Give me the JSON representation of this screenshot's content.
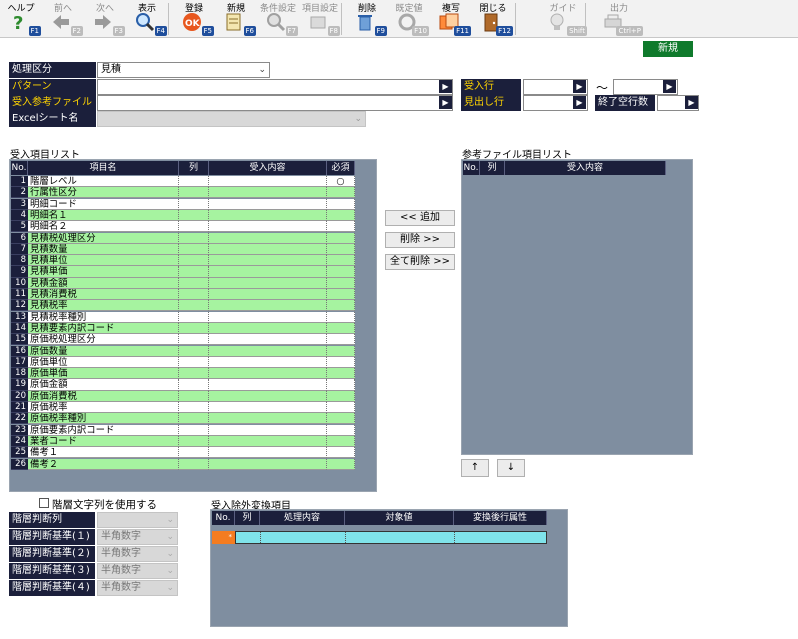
{
  "toolbar": {
    "items": [
      {
        "label": "ヘルプ",
        "key": "F1",
        "icon": "help-icon",
        "disabled": false
      },
      {
        "label": "前へ",
        "key": "F2",
        "icon": "arrow-left-icon",
        "disabled": true
      },
      {
        "label": "次へ",
        "key": "F3",
        "icon": "arrow-right-icon",
        "disabled": true
      },
      {
        "label": "表示",
        "key": "F4",
        "icon": "magnifier-icon",
        "disabled": false
      },
      {
        "label": "登録",
        "key": "F5",
        "icon": "ok-icon",
        "disabled": false
      },
      {
        "label": "新規",
        "key": "F6",
        "icon": "new-document-icon",
        "disabled": false
      },
      {
        "label": "条件設定",
        "key": "F7",
        "icon": "condition-search-icon",
        "disabled": true
      },
      {
        "label": "項目設定",
        "key": "F8",
        "icon": "item-settings-icon",
        "disabled": true
      },
      {
        "label": "削除",
        "key": "F9",
        "icon": "trash-icon",
        "disabled": false
      },
      {
        "label": "既定値",
        "key": "F10",
        "icon": "default-value-icon",
        "disabled": true
      },
      {
        "label": "複写",
        "key": "F11",
        "icon": "copy-icon",
        "disabled": false
      },
      {
        "label": "閉じる",
        "key": "F12",
        "icon": "close-door-icon",
        "disabled": false
      },
      {
        "label": "ガイド",
        "key": "Shift",
        "icon": "lightbulb-icon",
        "disabled": true
      },
      {
        "label": "出力",
        "key": "Ctrl+P",
        "icon": "print-icon",
        "disabled": true
      }
    ],
    "colors": {
      "fkey": "#1f4e9c",
      "fkey_disabled": "#bcbcbc"
    }
  },
  "mode_badge": "新規",
  "form": {
    "kubun_label": "処理区分",
    "kubun_value": "見積",
    "pattern_label": "パターン",
    "pattern_value": "",
    "ref_file_label": "受入参考ファイル",
    "ref_file_value": "",
    "sheet_label": "Excelシート名",
    "sheet_value": "",
    "import_row_label": "受入行",
    "import_row_from": "",
    "tilde": "～",
    "import_row_to": "",
    "header_row_label": "見出し行",
    "header_row_value": "",
    "end_blank_label": "終了空行数",
    "end_blank_value": ""
  },
  "import_list": {
    "title": "受入項目リスト",
    "headers": [
      "No.",
      "項目名",
      "列",
      "受入内容",
      "必須"
    ],
    "rows": [
      {
        "no": "1",
        "name": "階層レベル",
        "required": "○"
      },
      {
        "no": "2",
        "name": "行属性区分",
        "required": ""
      },
      {
        "no": "3",
        "name": "明細コード",
        "required": ""
      },
      {
        "no": "4",
        "name": "明細名１",
        "required": ""
      },
      {
        "no": "5",
        "name": "明細名２",
        "required": ""
      },
      {
        "no": "6",
        "name": "見積税処理区分",
        "required": ""
      },
      {
        "no": "7",
        "name": "見積数量",
        "required": ""
      },
      {
        "no": "8",
        "name": "見積単位",
        "required": ""
      },
      {
        "no": "9",
        "name": "見積単価",
        "required": ""
      },
      {
        "no": "10",
        "name": "見積金額",
        "required": ""
      },
      {
        "no": "11",
        "name": "見積消費税",
        "required": ""
      },
      {
        "no": "12",
        "name": "見積税率",
        "required": ""
      },
      {
        "no": "13",
        "name": "見積税率種別",
        "required": ""
      },
      {
        "no": "14",
        "name": "見積要素内訳コード",
        "required": ""
      },
      {
        "no": "15",
        "name": "原価税処理区分",
        "required": ""
      },
      {
        "no": "16",
        "name": "原価数量",
        "required": ""
      },
      {
        "no": "17",
        "name": "原価単位",
        "required": ""
      },
      {
        "no": "18",
        "name": "原価単価",
        "required": ""
      },
      {
        "no": "19",
        "name": "原価金額",
        "required": ""
      },
      {
        "no": "20",
        "name": "原価消費税",
        "required": ""
      },
      {
        "no": "21",
        "name": "原価税率",
        "required": ""
      },
      {
        "no": "22",
        "name": "原価税率種別",
        "required": ""
      },
      {
        "no": "23",
        "name": "原価要素内訳コード",
        "required": ""
      },
      {
        "no": "24",
        "name": "業者コード",
        "required": ""
      },
      {
        "no": "25",
        "name": "備考１",
        "required": ""
      },
      {
        "no": "26",
        "name": "備考２",
        "required": ""
      }
    ],
    "colors": {
      "green": "#a6f3a0",
      "white": "#ffffff"
    }
  },
  "buttons": {
    "add": "<< 追加",
    "remove": "削除 >>",
    "remove_all": "全て削除 >>",
    "up": "↑",
    "down": "↓"
  },
  "ref_list": {
    "title": "参考ファイル項目リスト",
    "headers": [
      "No.",
      "列",
      "受入内容"
    ]
  },
  "hierarchy": {
    "checkbox_label": "階層文字列を使用する",
    "checked": false,
    "col_label": "階層判断列",
    "col_value": "",
    "criteria": [
      {
        "label": "階層判断基準(１)",
        "value": "半角数字"
      },
      {
        "label": "階層判断基準(２)",
        "value": "半角数字"
      },
      {
        "label": "階層判断基準(３)",
        "value": "半角数字"
      },
      {
        "label": "階層判断基準(４)",
        "value": "半角数字"
      }
    ]
  },
  "exclude_conv": {
    "title": "受入除外変換項目",
    "headers": [
      "No.",
      "列",
      "処理内容",
      "対象値",
      "変換後行属性"
    ],
    "new_row_marker": "*"
  },
  "theme": {
    "label_bg": "#1b1f3b",
    "label_yellow": "#ffd400",
    "panel_bg": "#7f8ea0",
    "badge_green": "#0f7a2c",
    "row_new": "#7fe3ea"
  }
}
